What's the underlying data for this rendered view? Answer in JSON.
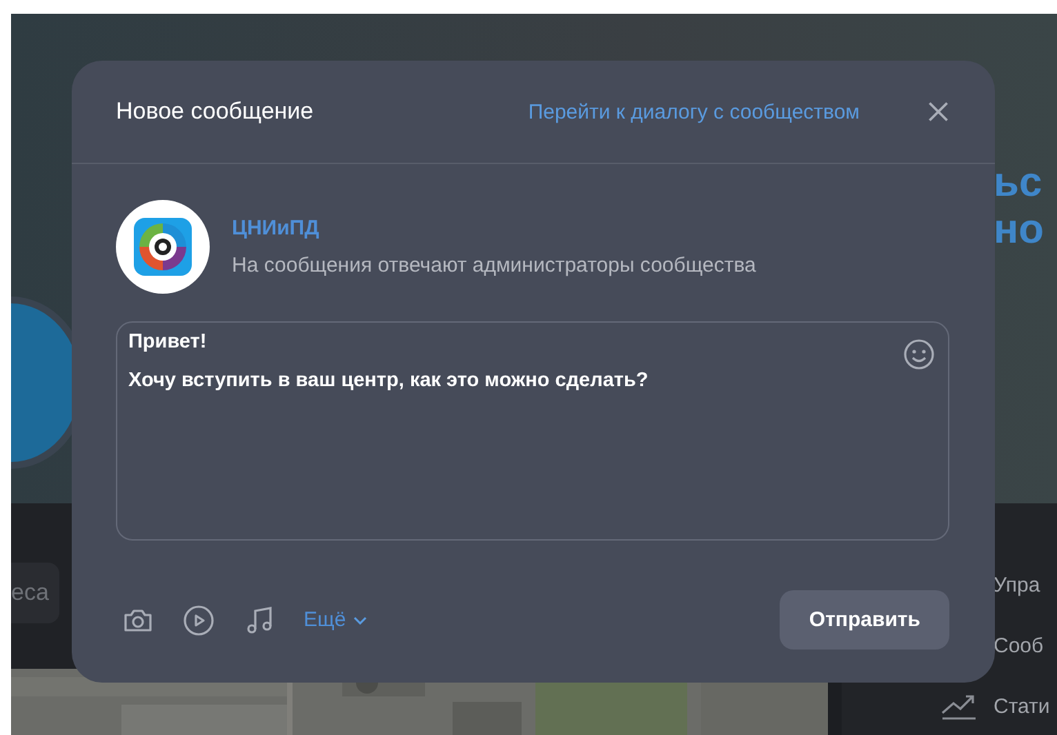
{
  "background": {
    "banner_lines": [
      "ьс",
      "но"
    ],
    "search_text": "еса",
    "side_menu": [
      {
        "label": "Упра"
      },
      {
        "label": "Сооб"
      },
      {
        "label": "Стати",
        "has_icon": true
      }
    ]
  },
  "dialog": {
    "title": "Новое сообщение",
    "link": "Перейти к диалогу с сообществом",
    "community": {
      "name": "ЦНИиПД",
      "subtitle": "На сообщения отвечают администраторы сообщества"
    },
    "message": "Привет!\nХочу вступить в ваш центр, как это можно сделать?",
    "more": "Ещё",
    "send": "Отправить"
  }
}
